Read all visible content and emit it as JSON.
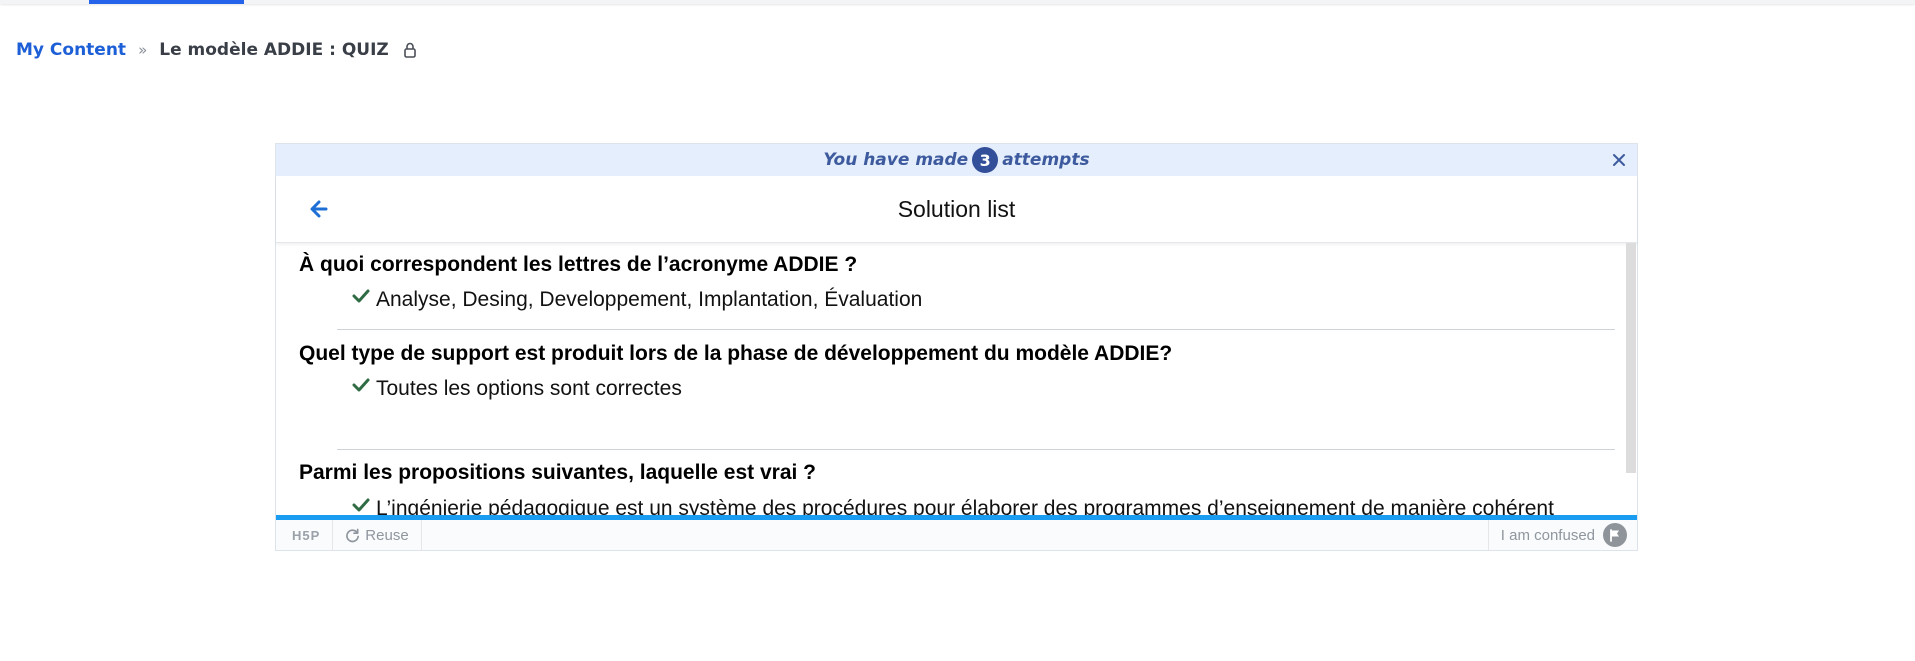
{
  "breadcrumb": {
    "root": "My Content",
    "separator": "»",
    "current": "Le modèle ADDIE : QUIZ"
  },
  "attempts": {
    "prefix": "You have made",
    "count": "3",
    "suffix": "attempts"
  },
  "solution_header": {
    "title": "Solution list"
  },
  "questions": [
    {
      "question": "À quoi correspondent les lettres de l’acronyme ADDIE ?",
      "answer": "Analyse, Desing, Developpement, Implantation, Évaluation"
    },
    {
      "question": "Quel type de support est produit lors de la phase de développement du modèle ADDIE?",
      "answer": "Toutes les options sont correctes"
    },
    {
      "question": "Parmi les propositions suivantes, laquelle est vrai ?",
      "answer": "L’ingénierie pédagogique est un système des procédures pour élaborer des programmes d’enseignement de manière cohérent"
    }
  ],
  "footer": {
    "logo": "H5P",
    "reuse_label": "Reuse",
    "confused_label": "I am confused"
  },
  "icons": {
    "lock": "lock-icon",
    "close": "close-icon",
    "back": "arrow-left-icon",
    "check": "check-icon",
    "reuse": "refresh-icon",
    "flag": "flag-icon"
  },
  "colors": {
    "link": "#1d5fd6",
    "attempts_bg": "#e5eefc",
    "attempts_text": "#3d5a9e",
    "badge": "#344f99",
    "check": "#2f6b43",
    "progress": "#1a9cf1",
    "nav_active": "#2563eb"
  }
}
